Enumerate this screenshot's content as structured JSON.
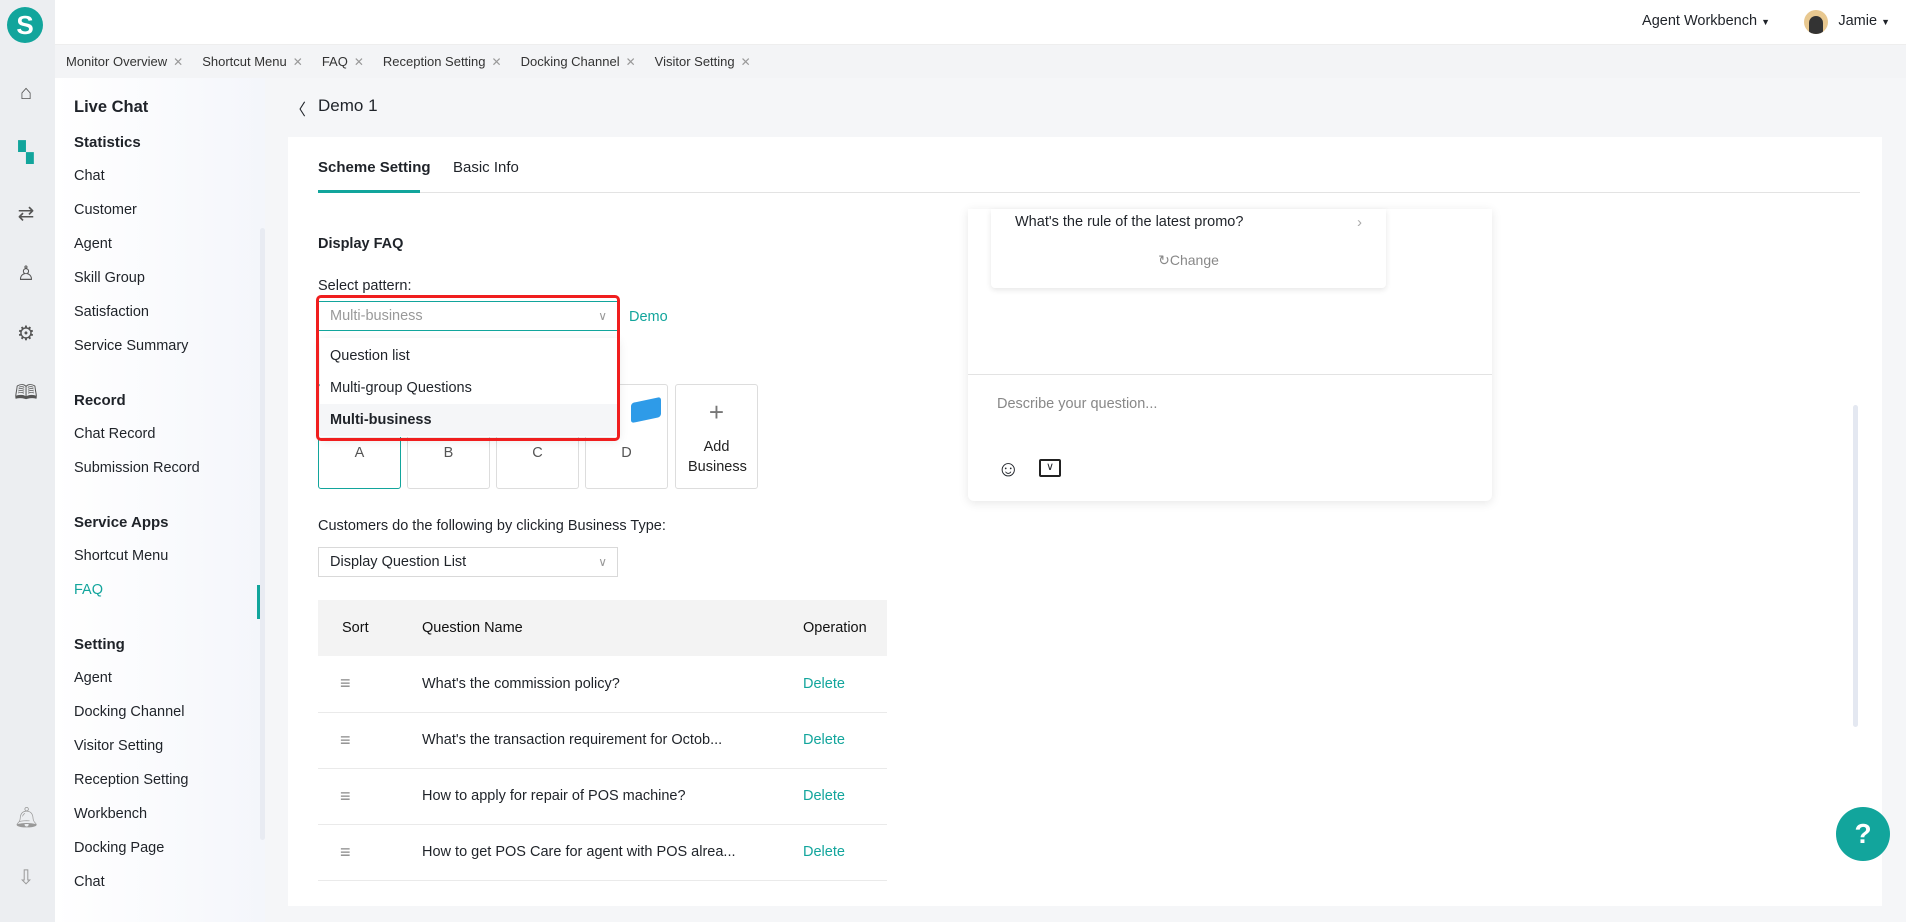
{
  "brand": {
    "logo_letter": "S",
    "accent": "#12a59c",
    "highlight": "#f01e1e"
  },
  "topbar": {
    "workbench": "Agent Workbench",
    "user": "Jamie"
  },
  "rail_icons": [
    "home-icon",
    "apps-icon",
    "route-icon",
    "user-icon",
    "gear-icon",
    "book-icon",
    "bell-icon",
    "download-icon"
  ],
  "tabs": [
    "Monitor Overview",
    "Shortcut Menu",
    "FAQ",
    "Reception Setting",
    "Docking Channel",
    "Visitor Setting"
  ],
  "sidebar": {
    "title": "Live Chat",
    "groups": [
      {
        "heading": "Statistics",
        "items": [
          "Chat",
          "Customer",
          "Agent",
          "Skill Group",
          "Satisfaction",
          "Service Summary"
        ]
      },
      {
        "heading": "Record",
        "items": [
          "Chat Record",
          "Submission Record"
        ]
      },
      {
        "heading": "Service Apps",
        "items": [
          "Shortcut Menu",
          "FAQ"
        ]
      },
      {
        "heading": "Setting",
        "items": [
          "Agent",
          "Docking Channel",
          "Visitor Setting",
          "Reception Setting",
          "Workbench",
          "Docking Page",
          "Chat"
        ]
      }
    ],
    "active": "FAQ"
  },
  "page": {
    "title": "Demo 1",
    "tabs": [
      "Scheme Setting",
      "Basic Info"
    ],
    "active_tab": "Scheme Setting"
  },
  "form": {
    "section": "Display FAQ",
    "pattern_label": "Select pattern:",
    "pattern_value": "Multi-business",
    "demo_link": "Demo",
    "pattern_options": [
      "Question list",
      "Multi-group Questions",
      "Multi-business"
    ],
    "businesses": [
      "A",
      "B",
      "C",
      "D"
    ],
    "add_business": "Add Business",
    "click_label": "Customers do the following by clicking Business Type:",
    "click_value": "Display Question List"
  },
  "table": {
    "headers": [
      "Sort",
      "Question Name",
      "Operation"
    ],
    "rows": [
      {
        "name": "What's the commission policy?",
        "op": "Delete"
      },
      {
        "name": "What's the transaction requirement for Octob...",
        "op": "Delete"
      },
      {
        "name": "How to apply for repair of POS machine?",
        "op": "Delete"
      },
      {
        "name": "How to get POS Care for agent with POS alrea...",
        "op": "Delete"
      }
    ]
  },
  "preview": {
    "question": "What's the rule of the latest promo?",
    "change": "Change",
    "placeholder": "Describe your question..."
  }
}
